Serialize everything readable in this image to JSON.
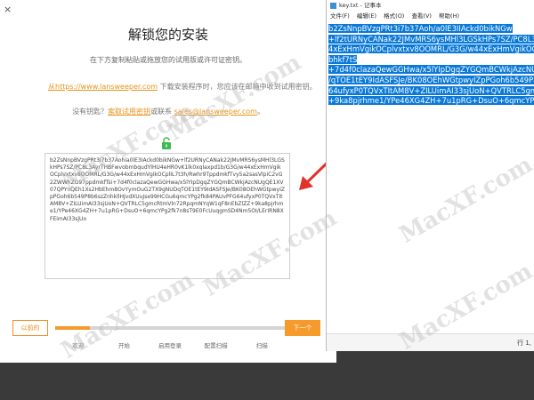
{
  "installer": {
    "close_label": "×",
    "title": "解锁您的安装",
    "subtitle": "在下方复制粘贴或拖放您的试用版或许可证密钥。",
    "step1_link": "从https://www.lansweeper.com",
    "step1_rest": " 下载安装程序时，您应该在邮箱中收到试用密钥。",
    "step2_prefix": "没有钥匙？",
    "step2_link": "索取试用密钥",
    "step2_mid": "或联系 ",
    "step2_email": "sales@lansweeper.com",
    "step2_suffix": "。",
    "key_text": "b2ZsNnpBVzgPRt3i7b37Aohia0lE3IAckd0bikNGw+lf2URNyCANak22JMvMRS6ysMHl3LGSkHPs7SZ/PC8L3AyrTHBFwvobmbqudYlHU4eHR0vK1lk0xqlaxpd1b/G3G/w44xExHmVgikOCplvxtxv8OOMRL/G3G/w44xExHmVgikOCplIL7t3h/Rwhr9TppdmkfTvy5a2sasVlpiC2vG2ZWWhZG97ppdmkfTsi+7d4f0clazaQewGGHwa/x5lYIpDgqZYGQmBCWkjAzcNUgQE1XV07QPYnQEh1Xs2HbEhm8OvYymOuG2TX9gNUDqTOE1tEY9IdASFSJe/BK08OEhWGtpwyIZpPGoh6b549P8b6szZnhkllHJvdXUuJse99HCGu6qmcYPg2fk84PAUvPFG64ufyxP0TQVxTItAM8V+ZILUimAI33sjUoN+QVTRLC5gmcRtmVln72RpqmNYqW1qF8nEbZlZZ+9ka8pjrhme1/YPe46XG4ZH+7u1pRG+DsuO+6qmcYPg2fk7n8sT9E0FcUuqgmSD4Nm5OI/LErIRN8XFEimAI33sjUo",
    "back_label": "以前的",
    "next_label": "下一个",
    "progress_fraction": 0.15,
    "steps": [
      "欢迎",
      "开始",
      "启用登录",
      "配置扫描",
      "扫描"
    ]
  },
  "notepad": {
    "title": "key.txt - 记事本",
    "menu": [
      "文件(F)",
      "编辑(E)",
      "格式(O)",
      "查看(V)",
      "帮助(H)"
    ],
    "lines": [
      "b2ZsNnpBVzgPRt3i7b37Aoh/a0lE3IIAckd0bikNGw",
      "+lf2tURNyCANak22JMvMRS6ysMHl3LGSkHPs7SZ/PC8L3AyrTHBFwv",
      "4xExHmVgikOCplvxtxv8OOMRL/G3G/w44xExHmVgikOCplIL7t3h/R",
      "bhkf7tS",
      "+7d4f0clazaQewGGHwa/x5lYIpDgqZYGQmBCWkjAzcNUgQE1XV07",
      "/qTOE1tEY9IdASFSJe/BK08OEhWGtpwyIZpPGoh6b549P8b6szZnhk",
      "64ufyxP0TQVxTItAM8V+ZILUimAI33sjUoN+QVTRLC5gmcRtmVln72",
      "+9ka8pjrhme1/YPe46XG4ZH+7u1pRG+DsuO+6qmcYPg2fk7n8sT9E0"
    ],
    "status": "行 1,"
  },
  "watermarks": [
    "MacXF.com",
    "MacXF.com",
    "MacXF.com",
    "MacXF.com",
    "MacXF.com",
    "MacXF.com"
  ],
  "colors": {
    "accent": "#f59a2b",
    "selection": "#0a79d8",
    "arrow": "#e0332b"
  }
}
